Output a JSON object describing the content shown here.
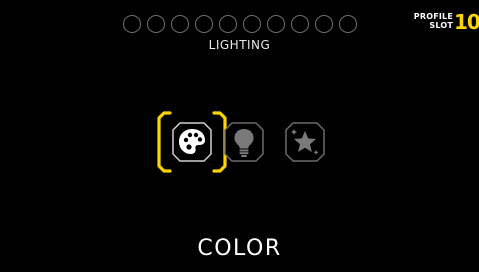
{
  "header": {
    "profile_label": "PROFILE SLOT",
    "profile_slot_number": "10"
  },
  "menu": {
    "title": "LIGHTING"
  },
  "lighting_modes": [
    {
      "icon": "palette-icon",
      "selected": true
    },
    {
      "icon": "lightbulb-icon",
      "selected": false
    },
    {
      "icon": "star-sparkle-icon",
      "selected": false
    }
  ],
  "selection_label": "COLOR",
  "colors": {
    "accent": "#ffd400",
    "inactive_icon": "#7a7a7a",
    "slot_outline": "#6f6f6f"
  }
}
